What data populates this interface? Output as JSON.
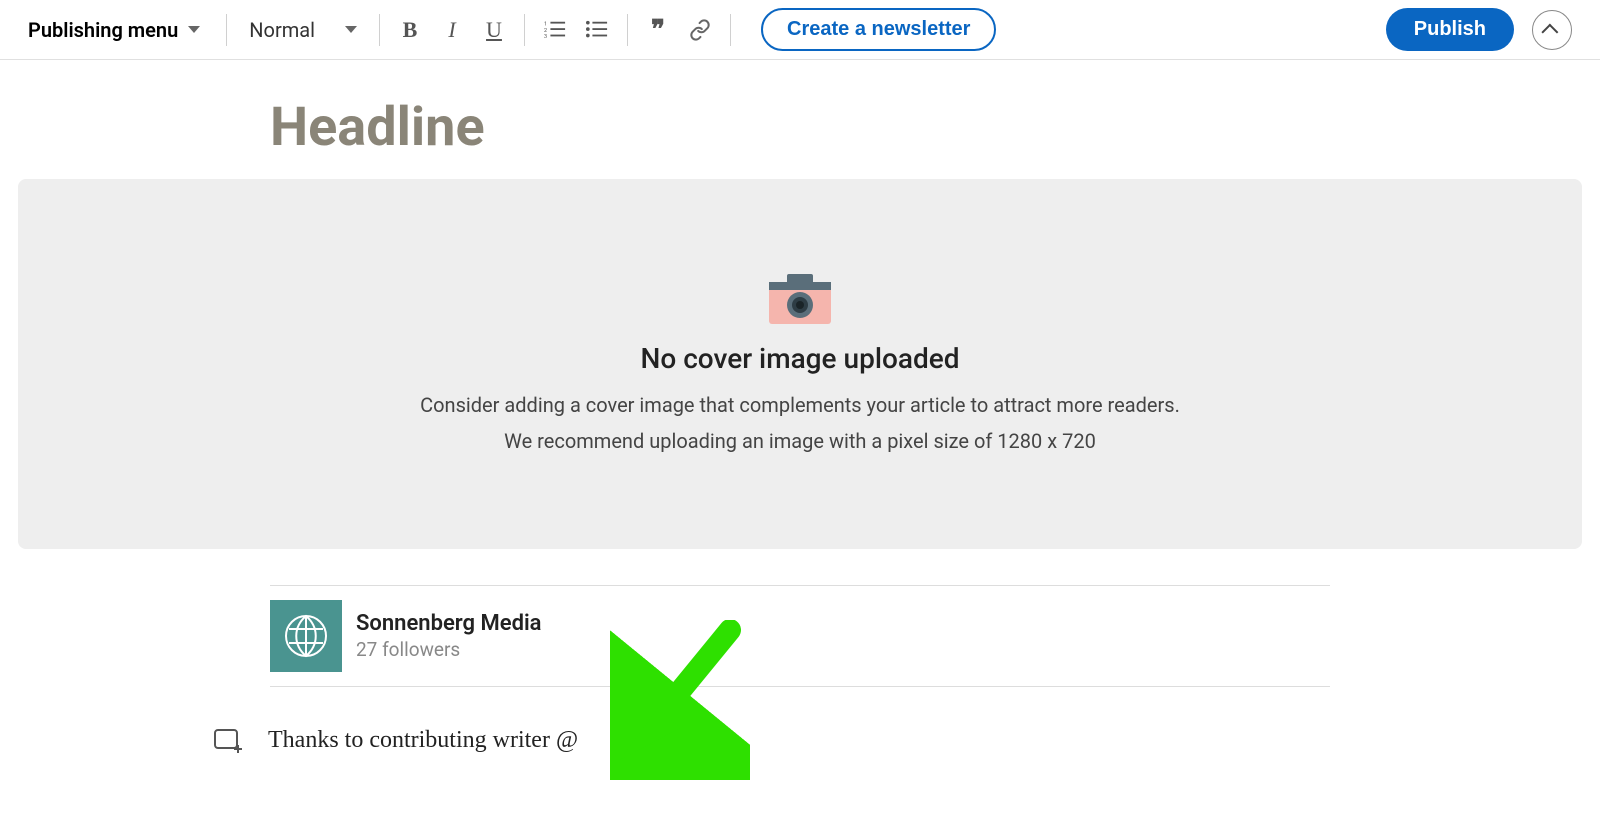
{
  "toolbar": {
    "publishing_menu_label": "Publishing menu",
    "style_selected": "Normal",
    "newsletter_button": "Create a newsletter",
    "publish_button": "Publish"
  },
  "editor": {
    "headline_placeholder": "Headline",
    "cover": {
      "title": "No cover image uploaded",
      "subtitle_line1": "Consider adding a cover image that complements your article to attract more readers.",
      "subtitle_line2": "We recommend uploading an image with a pixel size of 1280 x 720"
    },
    "author": {
      "name": "Sonnenberg Media",
      "followers": "27 followers"
    },
    "body_text": "Thanks to contributing writer @"
  },
  "annotation": {
    "arrow_color": "#2ee000"
  }
}
